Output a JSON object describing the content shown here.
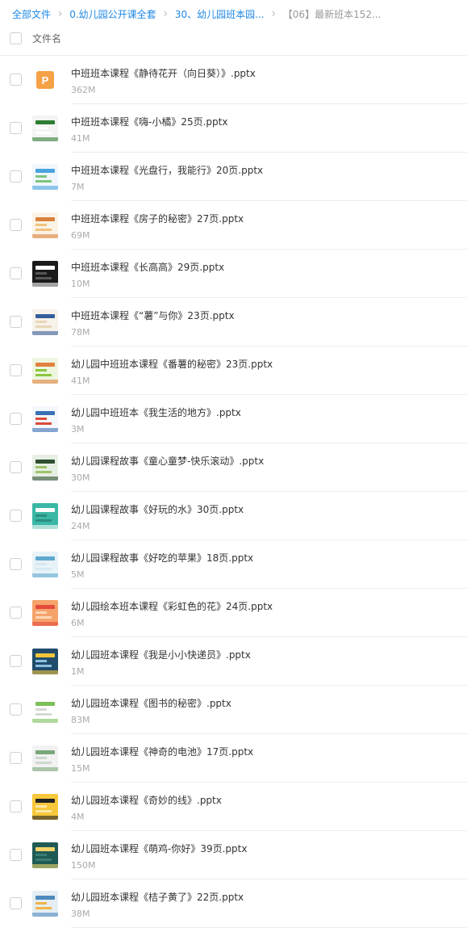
{
  "breadcrumb": {
    "items": [
      {
        "label": "全部文件"
      },
      {
        "label": "0.幼儿园公开课全套"
      },
      {
        "label": "30、幼儿园班本园..."
      }
    ],
    "current": "【06】最新班本152..."
  },
  "table": {
    "header_label": "文件名"
  },
  "files": [
    {
      "name": "中班班本课程《静待花开（向日葵）》.pptx",
      "size": "362M",
      "icon": "ppt-file-icon"
    },
    {
      "name": "中班班本课程《嗨-小橘》25页.pptx",
      "size": "41M",
      "icon": "slide-thumbnail"
    },
    {
      "name": "中班班本课程《光盘行，我能行》20页.pptx",
      "size": "7M",
      "icon": "slide-thumbnail"
    },
    {
      "name": "中班班本课程《房子的秘密》27页.pptx",
      "size": "69M",
      "icon": "slide-thumbnail"
    },
    {
      "name": "中班班本课程《长高高》29页.pptx",
      "size": "10M",
      "icon": "slide-thumbnail"
    },
    {
      "name": "中班班本课程《“薯”与你》23页.pptx",
      "size": "78M",
      "icon": "slide-thumbnail"
    },
    {
      "name": "幼儿园中班班本课程《番薯的秘密》23页.pptx",
      "size": "41M",
      "icon": "slide-thumbnail"
    },
    {
      "name": "幼儿园中班班本《我生活的地方》.pptx",
      "size": "3M",
      "icon": "slide-thumbnail"
    },
    {
      "name": "幼儿园课程故事《童心童梦-快乐滚动》.pptx",
      "size": "30M",
      "icon": "slide-thumbnail"
    },
    {
      "name": "幼儿园课程故事《好玩的水》30页.pptx",
      "size": "24M",
      "icon": "slide-thumbnail"
    },
    {
      "name": "幼儿园课程故事《好吃的苹果》18页.pptx",
      "size": "5M",
      "icon": "slide-thumbnail"
    },
    {
      "name": "幼儿园绘本班本课程《彩虹色的花》24页.pptx",
      "size": "6M",
      "icon": "slide-thumbnail"
    },
    {
      "name": "幼儿园班本课程《我是小小快递员》.pptx",
      "size": "1M",
      "icon": "slide-thumbnail"
    },
    {
      "name": "幼儿园班本课程《图书的秘密》.pptx",
      "size": "83M",
      "icon": "slide-thumbnail"
    },
    {
      "name": "幼儿园班本课程《神奇的电池》17页.pptx",
      "size": "15M",
      "icon": "slide-thumbnail"
    },
    {
      "name": "幼儿园班本课程《奇妙的线》.pptx",
      "size": "4M",
      "icon": "slide-thumbnail"
    },
    {
      "name": "幼儿园班本课程《萌鸡-你好》39页.pptx",
      "size": "150M",
      "icon": "slide-thumbnail"
    },
    {
      "name": "幼儿园班本课程《桔子黄了》22页.pptx",
      "size": "38M",
      "icon": "slide-thumbnail"
    }
  ],
  "ppt_icon_glyph": "P",
  "colors": {
    "link": "#1e88e5",
    "ppt_icon": "#f5a146"
  }
}
